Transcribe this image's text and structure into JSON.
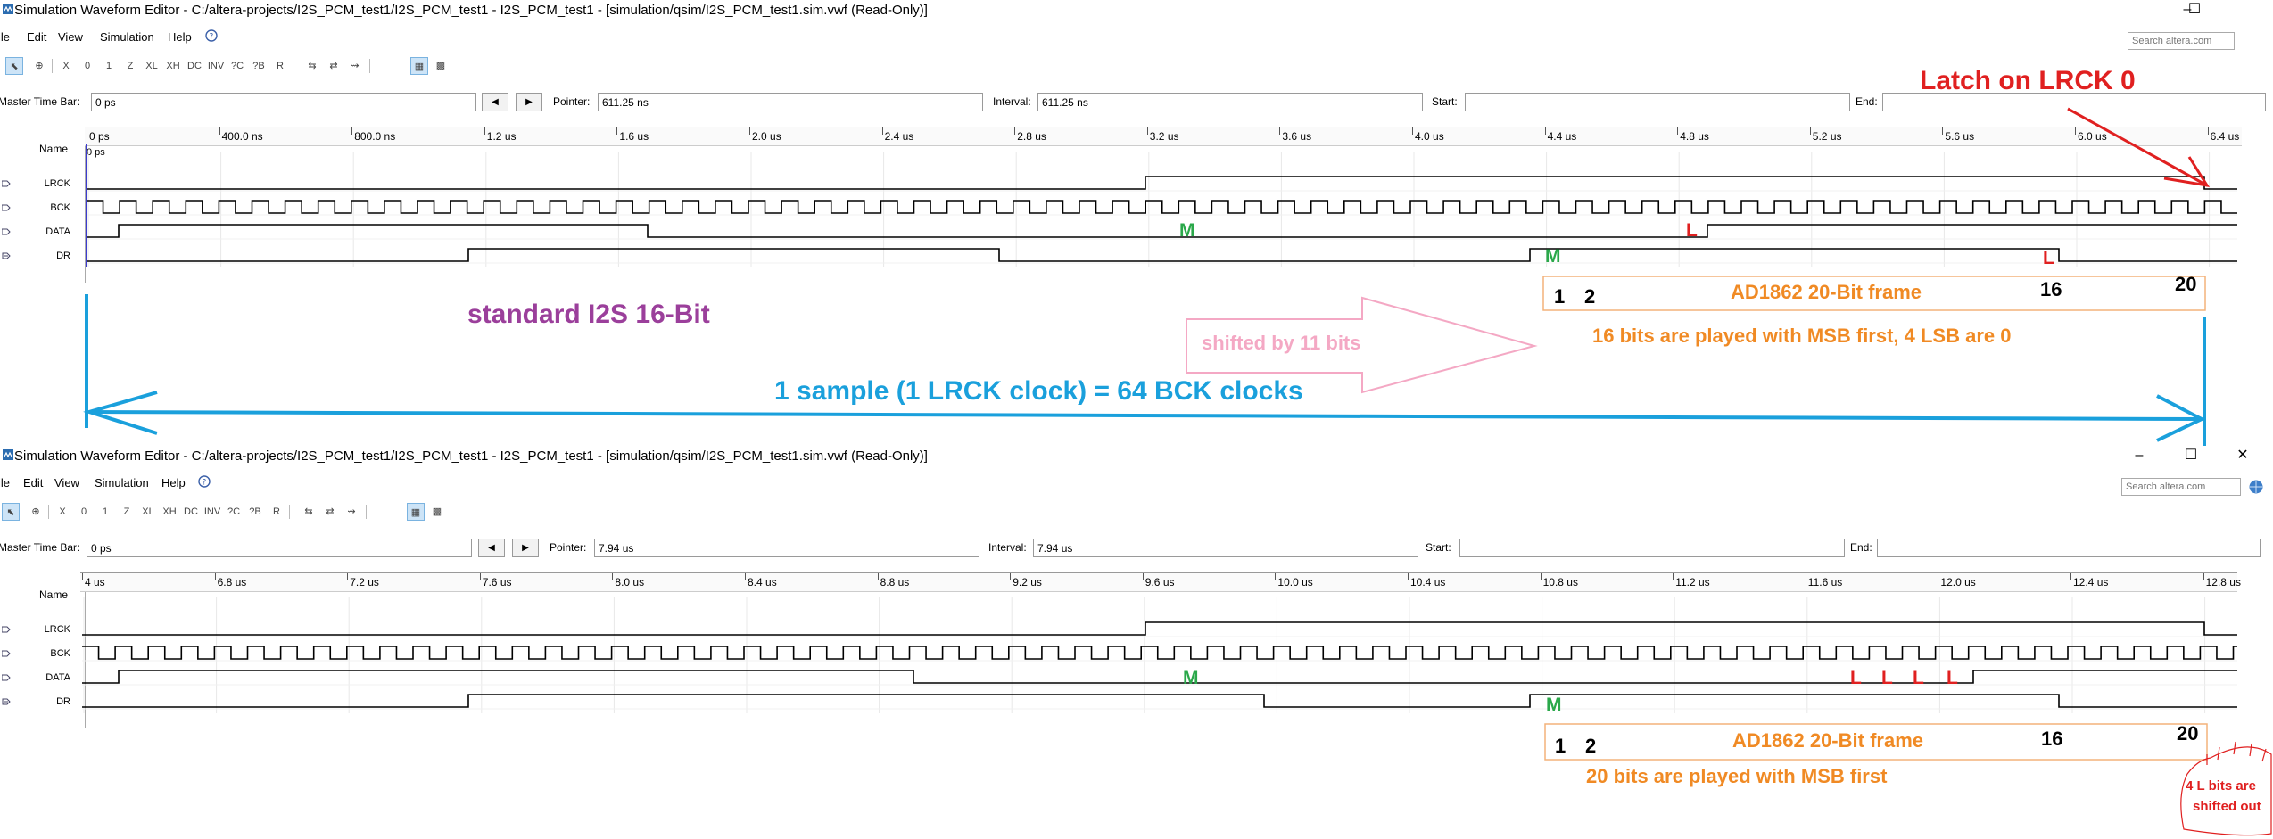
{
  "window1": {
    "title": "Simulation Waveform Editor - C:/altera-projects/I2S_PCM_test1/I2S_PCM_test1 - I2S_PCM_test1 - [simulation/qsim/I2S_PCM_test1.sim.vwf (Read-Only)]",
    "menu": [
      "File",
      "Edit",
      "View",
      "Simulation",
      "Help"
    ],
    "search_placeholder": "Search altera.com",
    "master_time_bar_label": "Master Time Bar:",
    "master_time_bar_value": "0 ps",
    "pointer_label": "Pointer:",
    "pointer_value": "611.25 ns",
    "interval_label": "Interval:",
    "interval_value": "611.25 ns",
    "start_label": "Start:",
    "start_value": "",
    "end_label": "End:",
    "end_value": "",
    "name_header": "Name",
    "cursor_label": "0 ps",
    "signals": [
      "LRCK",
      "BCK",
      "DATA",
      "DR"
    ],
    "ticks": [
      "0 ps",
      "400.0 ns",
      "800.0 ns",
      "1.2 us",
      "1.6 us",
      "2.0 us",
      "2.4 us",
      "2.8 us",
      "3.2 us",
      "3.6 us",
      "4.0 us",
      "4.4 us",
      "4.8 us",
      "5.2 us",
      "5.6 us",
      "6.0 us",
      "6.4 us"
    ]
  },
  "window2": {
    "title": "Simulation Waveform Editor - C:/altera-projects/I2S_PCM_test1/I2S_PCM_test1 - I2S_PCM_test1 - [simulation/qsim/I2S_PCM_test1.sim.vwf (Read-Only)]",
    "menu": [
      "File",
      "Edit",
      "View",
      "Simulation",
      "Help"
    ],
    "search_placeholder": "Search altera.com",
    "master_time_bar_label": "Master Time Bar:",
    "master_time_bar_value": "0 ps",
    "pointer_label": "Pointer:",
    "pointer_value": "7.94 us",
    "interval_label": "Interval:",
    "interval_value": "7.94 us",
    "start_label": "Start:",
    "start_value": "",
    "end_label": "End:",
    "end_value": "",
    "name_header": "Name",
    "signals": [
      "LRCK",
      "BCK",
      "DATA",
      "DR"
    ],
    "ticks": [
      "4 us",
      "6.8 us",
      "7.2 us",
      "7.6 us",
      "8.0 us",
      "8.4 us",
      "8.8 us",
      "9.2 us",
      "9.6 us",
      "10.0 us",
      "10.4 us",
      "10.8 us",
      "11.2 us",
      "11.6 us",
      "12.0 us",
      "12.4 us",
      "12.8 us"
    ]
  },
  "annotations": {
    "latch": "Latch on LRCK 0",
    "standard": "standard I2S 16-Bit",
    "shifted": "shifted by 11 bits",
    "sample": "1 sample (1 LRCK clock) = 64 BCK clocks",
    "frame1_title": "AD1862 20-Bit frame",
    "frame1_note": "16 bits are played with MSB first, 4 LSB are 0",
    "frame2_title": "AD1862 20-Bit frame",
    "frame2_note": "20 bits are played with MSB first",
    "frame_n1": "1",
    "frame_n2": "2",
    "frame_n16": "16",
    "frame_n20": "20",
    "shifted_out_1": "4 L bits are",
    "shifted_out_2": "shifted out",
    "m": "M",
    "l": "L"
  },
  "colors": {
    "purple": "#9b3f9b",
    "blue": "#1aa0dc",
    "orange": "#f08a24",
    "green": "#2aa84a",
    "red": "#e02020",
    "pink": "#f4a8c4"
  }
}
